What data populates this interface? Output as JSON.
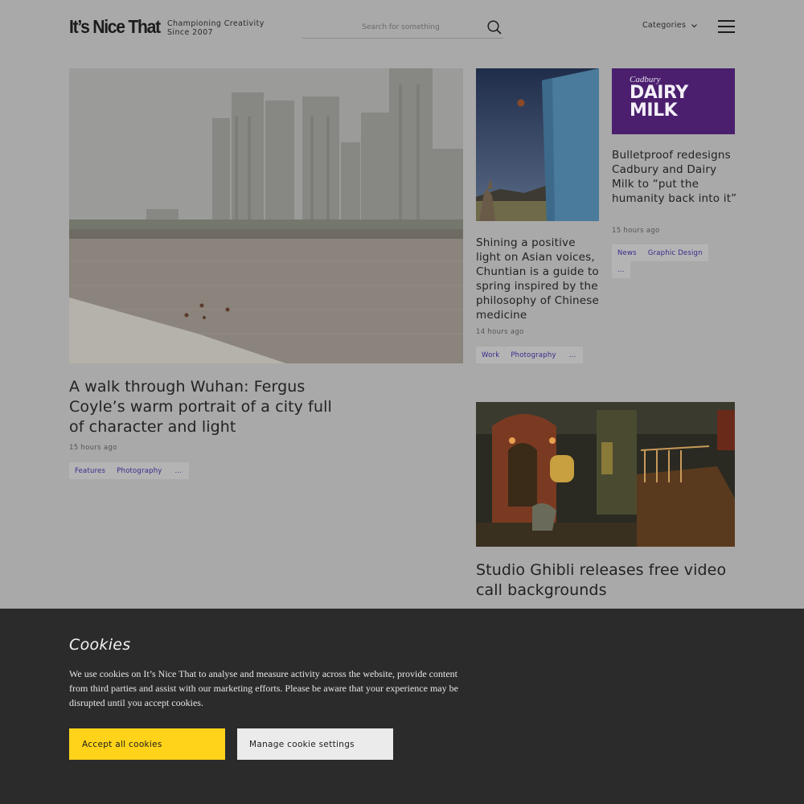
{
  "header": {
    "logo": "It’s Nice That",
    "tagline_line1": "Championing Creativity",
    "tagline_line2": "Since 2007",
    "search_placeholder": "Search for something",
    "categories_label": "Categories"
  },
  "articles": [
    {
      "title": "A walk through Wuhan: Fergus Coyle’s warm portrait of a city full of character and light",
      "time": "15 hours ago",
      "tags": [
        "Features",
        "Photography",
        "..."
      ]
    },
    {
      "title": "Shining a positive light on Asian voices, Chuntian is a guide to spring inspired by the philosophy of Chinese medicine",
      "time": "14 hours ago",
      "tags": [
        "Work",
        "Photography",
        "..."
      ]
    },
    {
      "title": "Bulletproof redesigns Cadbury and Dairy Milk to “put the humanity back into it”",
      "time": "15 hours ago",
      "tags": [
        "News",
        "Graphic Design",
        "..."
      ],
      "image_text_1": "Cadbury",
      "image_text_2": "DAIRY",
      "image_text_3": "MILK"
    },
    {
      "title": "Studio Ghibli releases free video call backgrounds"
    }
  ],
  "cookie": {
    "title": "Cookies",
    "text": "We use cookies on It’s Nice That to analyse and measure activity across the website, provide content from third parties and assist with our marketing efforts. Please be aware that your experience may be disrupted until you accept cookies.",
    "accept_label": "Accept all cookies",
    "manage_label": "Manage cookie settings"
  },
  "colors": {
    "accent_yellow": "#ffd319",
    "tag_text": "#3a2a8a",
    "cadbury_purple": "#4b1f6e"
  }
}
